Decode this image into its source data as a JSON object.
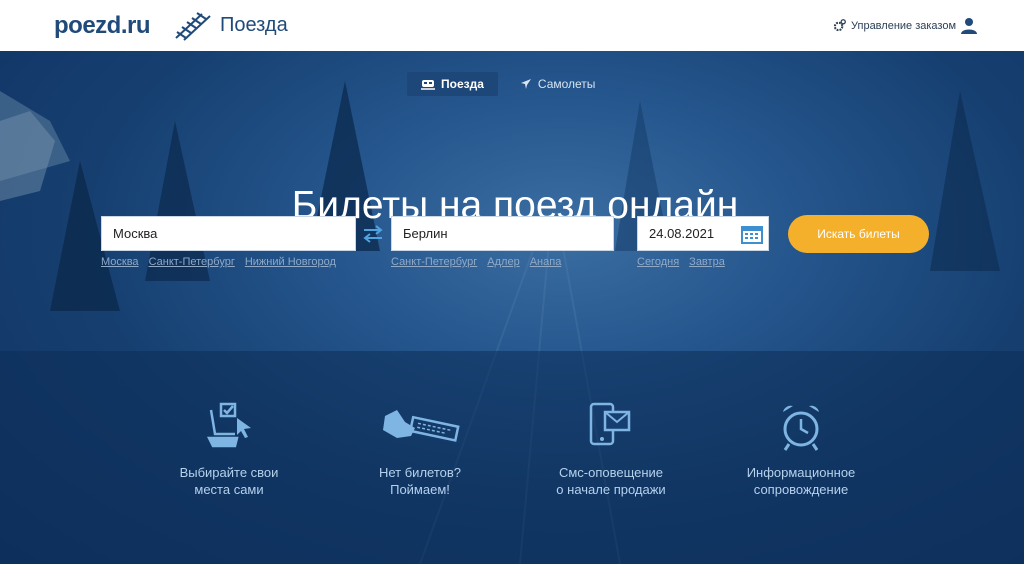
{
  "header": {
    "logo": "poezd.ru",
    "section": "Поезда",
    "manage_order": "Управление заказом"
  },
  "tabs": [
    {
      "label": "Поезда",
      "icon": "train-icon",
      "active": true
    },
    {
      "label": "Самолеты",
      "icon": "plane-icon",
      "active": false
    }
  ],
  "headline": "Билеты на поезд онлайн",
  "search": {
    "from_value": "Москва",
    "to_value": "Берлин",
    "date_value": "24.08.2021",
    "button_label": "Искать билеты",
    "from_suggestions": [
      "Москва",
      "Санкт-Петербург",
      "Нижний Новгород"
    ],
    "to_suggestions": [
      "Санкт-Петербург",
      "Адлер",
      "Анапа"
    ],
    "date_suggestions": [
      "Сегодня",
      "Завтра"
    ]
  },
  "features": [
    {
      "icon": "seat-select-icon",
      "label": "Выбирайте свои\nместа сами"
    },
    {
      "icon": "hand-ticket-icon",
      "label": "Нет билетов?\nПоймаем!"
    },
    {
      "icon": "phone-message-icon",
      "label": "Смс-оповещение\nо начале продажи"
    },
    {
      "icon": "alarm-clock-icon",
      "label": "Информационное\nсопровождение"
    }
  ],
  "colors": {
    "brand": "#1f4a7a",
    "accent": "#f5b02b",
    "hero": "#163f70"
  }
}
